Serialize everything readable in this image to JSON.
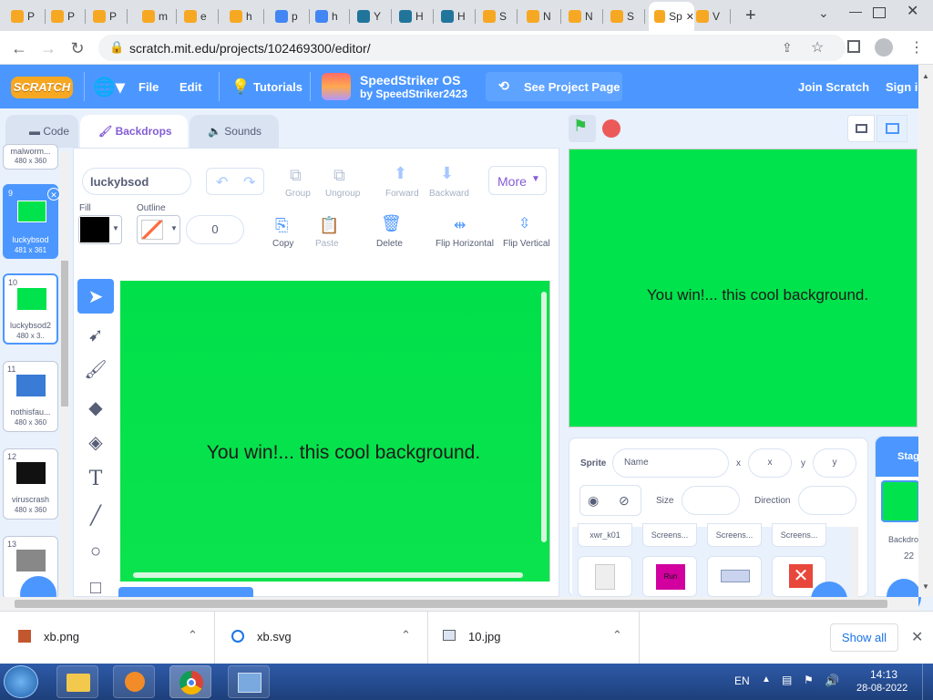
{
  "browser": {
    "tabs": [
      {
        "label": "P",
        "color": "#f7a823"
      },
      {
        "label": "P",
        "color": "#f7a823"
      },
      {
        "label": "P",
        "color": "#f7a823"
      },
      {
        "label": "m",
        "color": "#f7a823"
      },
      {
        "label": "e",
        "color": "#f7a823"
      },
      {
        "label": "h",
        "color": "#f7a823"
      },
      {
        "label": "p",
        "color": "#4285f4"
      },
      {
        "label": "h",
        "color": "#4285f4"
      },
      {
        "label": "Y",
        "color": "#21759b"
      },
      {
        "label": "H",
        "color": "#21759b"
      },
      {
        "label": "H",
        "color": "#21759b"
      },
      {
        "label": "S",
        "color": "#f7a823"
      },
      {
        "label": "N",
        "color": "#f7a823"
      },
      {
        "label": "N",
        "color": "#f7a823"
      },
      {
        "label": "S",
        "color": "#f7a823"
      },
      {
        "label": "Sp",
        "color": "#f7a823",
        "active": true
      },
      {
        "label": "V",
        "color": "#f7a823"
      }
    ],
    "url": "scratch.mit.edu/projects/102469300/editor/"
  },
  "header": {
    "logo": "SCRATCH",
    "file": "File",
    "edit": "Edit",
    "tutorials": "Tutorials",
    "project_title": "SpeedStriker OS",
    "project_author": "by SpeedStriker2423",
    "see_project": "See Project Page",
    "join": "Join Scratch",
    "signin": "Sign in"
  },
  "tabs": {
    "code": "Code",
    "backdrops": "Backdrops",
    "sounds": "Sounds"
  },
  "thumbnails": [
    {
      "num": "",
      "name": "malworm...",
      "size": "480 x 360",
      "color": "#e9e9e9"
    },
    {
      "num": "9",
      "name": "luckybsod",
      "size": "481 x 361",
      "color": "#00e34c",
      "selected": true
    },
    {
      "num": "10",
      "name": "luckybsod2",
      "size": "480 x 3..",
      "color": "#00e34c"
    },
    {
      "num": "11",
      "name": "nothisfau...",
      "size": "480 x 360",
      "color": "#3a7bd5"
    },
    {
      "num": "12",
      "name": "viruscrash",
      "size": "480 x 360",
      "color": "#111111"
    },
    {
      "num": "13",
      "name": "",
      "size": "",
      "color": "#888888"
    }
  ],
  "editor": {
    "costume_name": "luckybsod",
    "group": "Group",
    "ungroup": "Ungroup",
    "forward": "Forward",
    "backward": "Backward",
    "more": "More",
    "fill_label": "Fill",
    "outline_label": "Outline",
    "outline_width": "0",
    "copy": "Copy",
    "paste": "Paste",
    "delete": "Delete",
    "flip_h": "Flip Horizontal",
    "flip_v": "Flip Vertical",
    "canvas_text": "You win!... this cool background."
  },
  "stage": {
    "text": "You win!... this cool background."
  },
  "sprite": {
    "sprite_label": "Sprite",
    "name_placeholder": "Name",
    "x_label": "x",
    "x_placeholder": "x",
    "y_label": "y",
    "y_placeholder": "y",
    "size_label": "Size",
    "direction_label": "Direction",
    "items": [
      "xwr_k01",
      "Screens...",
      "Screens...",
      "Screens..."
    ],
    "sprite_text": "Run"
  },
  "stage_panel": {
    "label": "Stage",
    "backdrops_label": "Backdro...",
    "count": "22"
  },
  "downloads": {
    "items": [
      {
        "name": "xb.png"
      },
      {
        "name": "xb.svg"
      },
      {
        "name": "10.jpg"
      }
    ],
    "show_all": "Show all"
  },
  "taskbar": {
    "lang": "EN",
    "time": "14:13",
    "date": "28-08-2022"
  }
}
